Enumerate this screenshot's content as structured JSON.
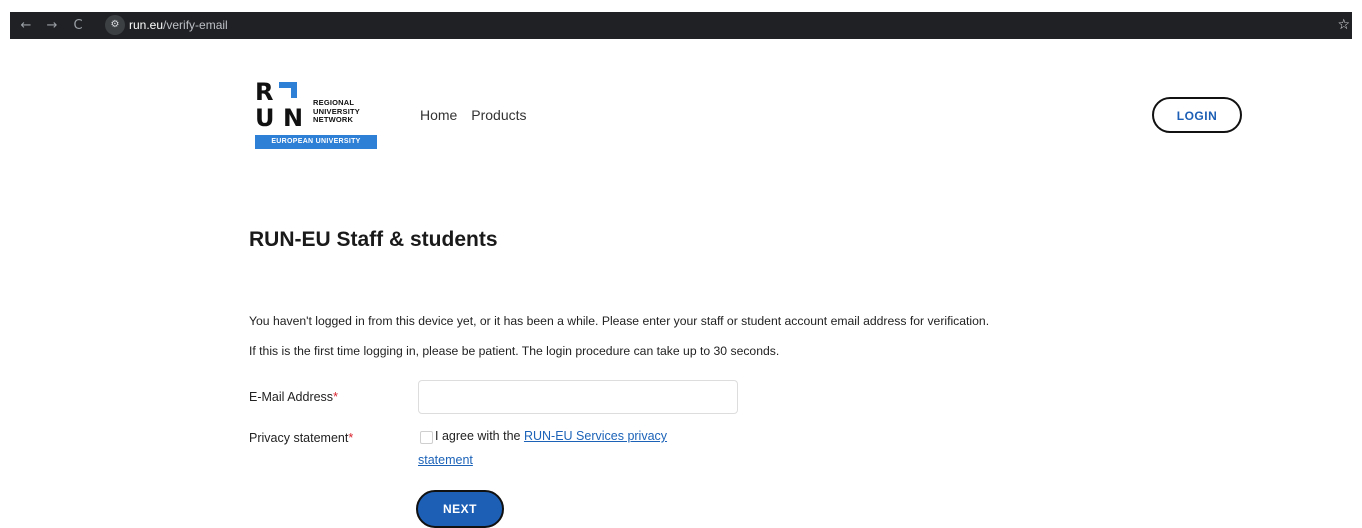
{
  "browser": {
    "url_domain": "run.eu",
    "url_path": "/verify-email",
    "back_icon": "←",
    "forward_icon": "→",
    "reload_icon": "C",
    "site_info_icon": "⚙",
    "bookmark_icon": "☆"
  },
  "header": {
    "logo": {
      "letter_r": "R",
      "letter_u": "U",
      "letter_n": "N",
      "line1": "REGIONAL",
      "line2": "UNIVERSITY",
      "line3": "NETWORK",
      "band": "EUROPEAN UNIVERSITY"
    },
    "nav": [
      {
        "label": "Home"
      },
      {
        "label": "Products"
      }
    ],
    "login_label": "LOGIN"
  },
  "main": {
    "title": "RUN-EU Staff & students",
    "paragraph1": "You haven't logged in from this device yet, or it has been a while. Please enter your staff or student account email address for verification.",
    "paragraph2": "If this is the first time logging in, please be patient. The login procedure can take up to 30 seconds.",
    "email_label": "E-Mail Address",
    "required_mark": "*",
    "email_value": "",
    "privacy_label": "Privacy statement",
    "agree_text": "I agree with the",
    "privacy_link_part1": "RUN-EU Services privacy",
    "privacy_link_part2": "statement",
    "next_label": "NEXT"
  },
  "colors": {
    "accent": "#1c5fb5",
    "brand_blue": "#2e7fd6",
    "required": "#d9232d"
  }
}
